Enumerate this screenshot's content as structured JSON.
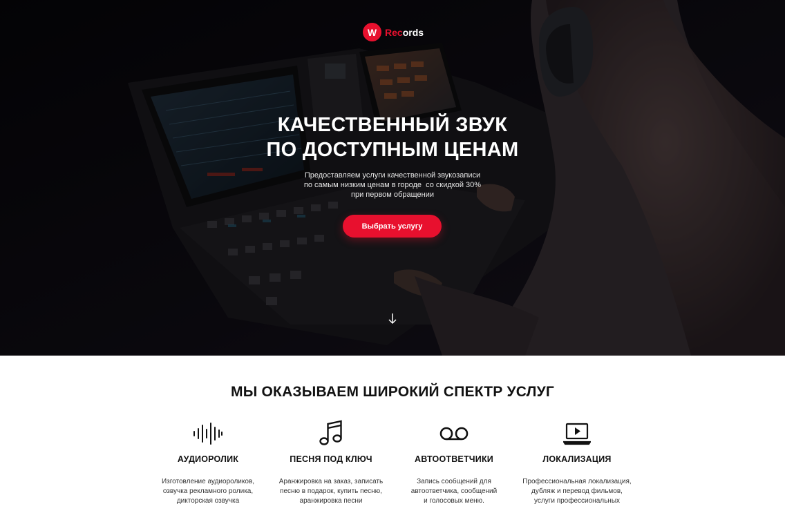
{
  "header": {
    "logo_letter": "W",
    "logo_accent": "Rec",
    "logo_rest": "ords"
  },
  "hero": {
    "title_line1": "КАЧЕСТВЕННЫЙ ЗВУК",
    "title_line2": "ПО ДОСТУПНЫМ ЦЕНАМ",
    "subtitle_line1": "Предоставляем услуги качественной звукозаписи",
    "subtitle_line2": "по самым низким ценам в городе  со скидкой 30%",
    "subtitle_line3": "при первом обращении",
    "cta_label": "Выбрать услугу",
    "scroll_icon": "arrow-down-icon"
  },
  "colors": {
    "accent": "#e8102e",
    "hero_bg": "#0d0b12"
  },
  "services": {
    "title": "МЫ ОКАЗЫВАЕМ ШИРОКИЙ СПЕКТР УСЛУГ",
    "items": [
      {
        "icon": "waveform-icon",
        "name": "АУДИОРОЛИК",
        "desc": "Изготовление аудиороликов,\nозвучка рекламного ролика,\nдикторская озвучка"
      },
      {
        "icon": "music-note-icon",
        "name": "ПЕСНЯ ПОД КЛЮЧ",
        "desc": "Аранжировка на заказ, записать\nпесню в подарок, купить песню,\nаранжировка песни"
      },
      {
        "icon": "voicemail-icon",
        "name": "АВТООТВЕТЧИКИ",
        "desc": "Запись сообщений для\nавтоответчика,   сообщений\nи голосовых меню."
      },
      {
        "icon": "laptop-play-icon",
        "name": "ЛОКАЛИЗАЦИЯ",
        "desc": "Профессиональная локализация,\nдубляж и перевод фильмов,\nуслуги профессиональных"
      }
    ]
  }
}
